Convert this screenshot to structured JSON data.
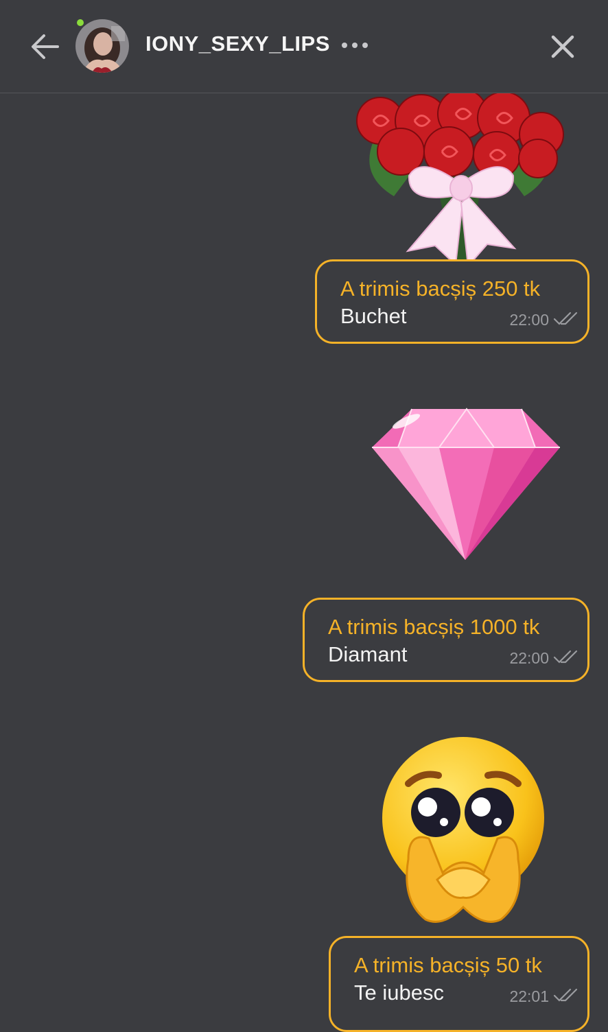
{
  "header": {
    "username": "IONY_SEXY_LIPS",
    "online": true,
    "icons": {
      "back": "arrow-left-icon",
      "more": "more-horizontal-icon",
      "close": "close-icon"
    }
  },
  "messages": [
    {
      "sticker": "rose-bouquet",
      "tip_text": "A trimis bacșiș 250 tk",
      "gift_name": "Buchet",
      "time": "22:00",
      "read": true
    },
    {
      "sticker": "pink-diamond",
      "tip_text": "A trimis bacșiș 1000 tk",
      "gift_name": "Diamant",
      "time": "22:00",
      "read": true
    },
    {
      "sticker": "pleading-heart-hands-emoji",
      "tip_text": "A trimis bacșiș 50 tk",
      "gift_name": "Te iubesc",
      "time": "22:01",
      "read": true
    }
  ],
  "colors": {
    "background": "#3b3c40",
    "accent": "#f5b228",
    "online": "#8bdc3c"
  }
}
